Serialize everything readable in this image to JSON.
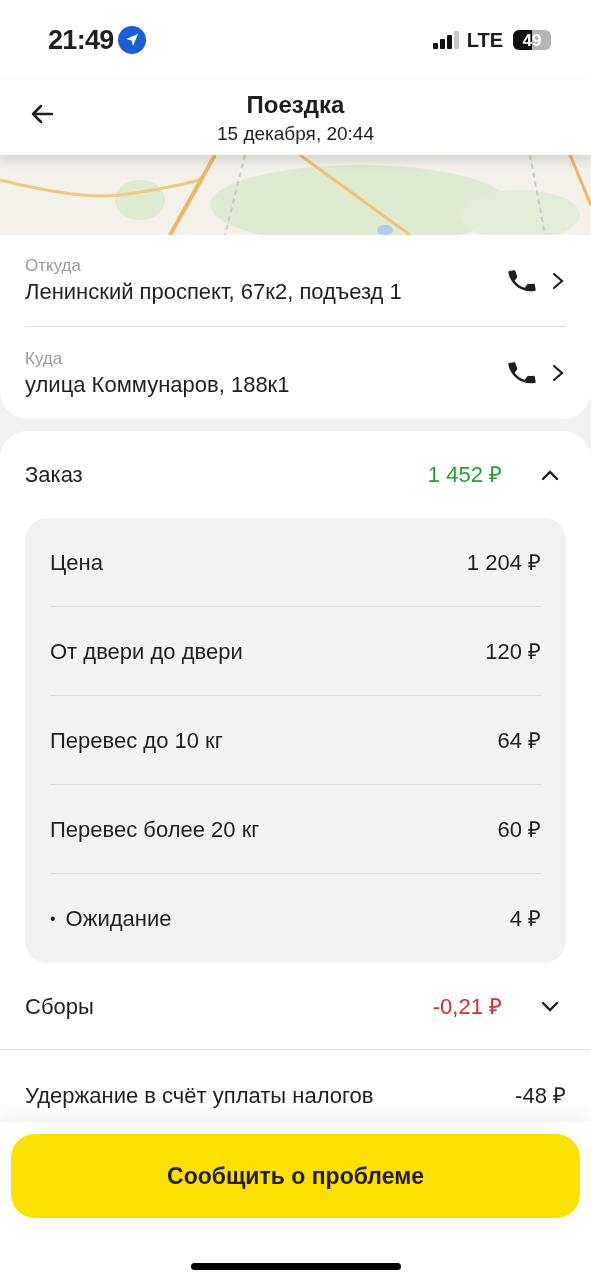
{
  "status_bar": {
    "time": "21:49",
    "network": "LTE",
    "battery": "49"
  },
  "header": {
    "title": "Поездка",
    "subtitle": "15 декабря, 20:44"
  },
  "route": [
    {
      "label": "Откуда",
      "address": "Ленинский проспект, 67к2, подъезд 1"
    },
    {
      "label": "Куда",
      "address": "улица Коммунаров, 188к1"
    }
  ],
  "sections": [
    {
      "title": "Заказ",
      "amount": "1 452 ₽",
      "color": "#21a038",
      "expanded": true,
      "items": [
        {
          "kind": "line",
          "label": "Цена",
          "amount": "1 204 ₽"
        },
        {
          "kind": "line",
          "label": "От двери до двери",
          "amount": "120 ₽"
        },
        {
          "kind": "line",
          "label": "Перевес до 10 кг",
          "amount": "64 ₽"
        },
        {
          "kind": "line",
          "label": "Перевес более 20 кг",
          "amount": "60 ₽"
        },
        {
          "kind": "sub",
          "bullet": "•",
          "label": "Ожидание",
          "amount": "4 ₽"
        }
      ]
    },
    {
      "title": "Сборы",
      "amount": "-0,21 ₽",
      "color": "#e0262f",
      "expanded": false
    }
  ],
  "tax": {
    "label": "Удержание в счёт уплаты налогов",
    "amount": "-48 ₽"
  },
  "action_button": "Сообщить о проблеме"
}
